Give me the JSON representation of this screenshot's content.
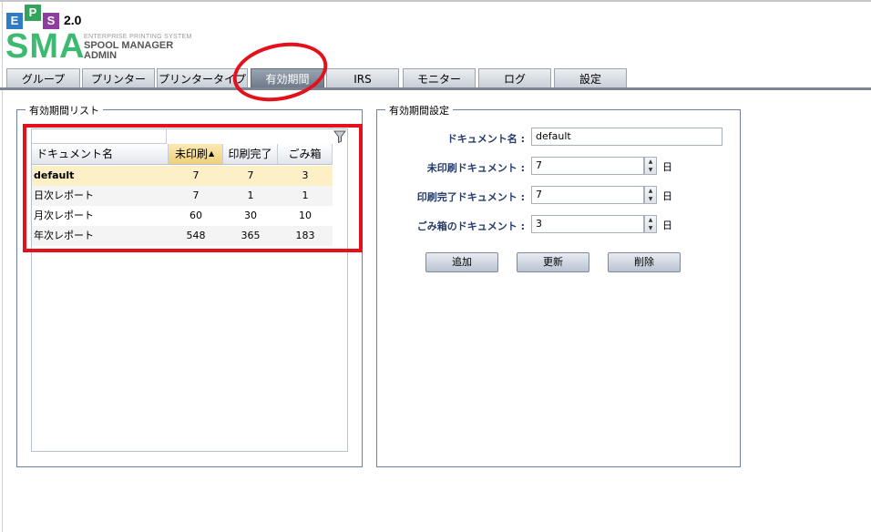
{
  "logo": {
    "letters": [
      "E",
      "P",
      "S"
    ],
    "version": "2.0",
    "product": "SMA",
    "tagline": "ENTERPRISE PRINTING SYSTEM",
    "line1": "SPOOL MANAGER",
    "line2": "ADMIN",
    "colors": [
      "#2e7cc4",
      "#34a35c",
      "#8e3c9e"
    ]
  },
  "tabs": [
    "グループ",
    "プリンター",
    "プリンタータイプ",
    "有効期間",
    "IRS",
    "モニター",
    "ログ",
    "設定"
  ],
  "active_tab": "有効期間",
  "list_panel": {
    "title": "有効期間リスト",
    "columns": [
      "ドキュメント名",
      "未印刷",
      "印刷完了",
      "ごみ箱"
    ],
    "sorted_column": "未印刷",
    "rows": [
      {
        "name": "default",
        "unprinted": "7",
        "printed": "7",
        "trash": "3"
      },
      {
        "name": "日次レポート",
        "unprinted": "7",
        "printed": "1",
        "trash": "1"
      },
      {
        "name": "月次レポート",
        "unprinted": "60",
        "printed": "30",
        "trash": "10"
      },
      {
        "name": "年次レポート",
        "unprinted": "548",
        "printed": "365",
        "trash": "183"
      }
    ]
  },
  "settings_panel": {
    "title": "有効期間設定",
    "doc_name_label": "ドキュメント名 :",
    "doc_name_value": "default",
    "unprinted_label": "未印刷ドキュメント :",
    "unprinted_value": "7",
    "printed_label": "印刷完了ドキュメント :",
    "printed_value": "7",
    "trash_label": "ごみ箱のドキュメント :",
    "trash_value": "3",
    "unit": "日",
    "buttons": {
      "add": "追加",
      "update": "更新",
      "delete": "削除"
    }
  },
  "annotation_color": "#e4101c"
}
